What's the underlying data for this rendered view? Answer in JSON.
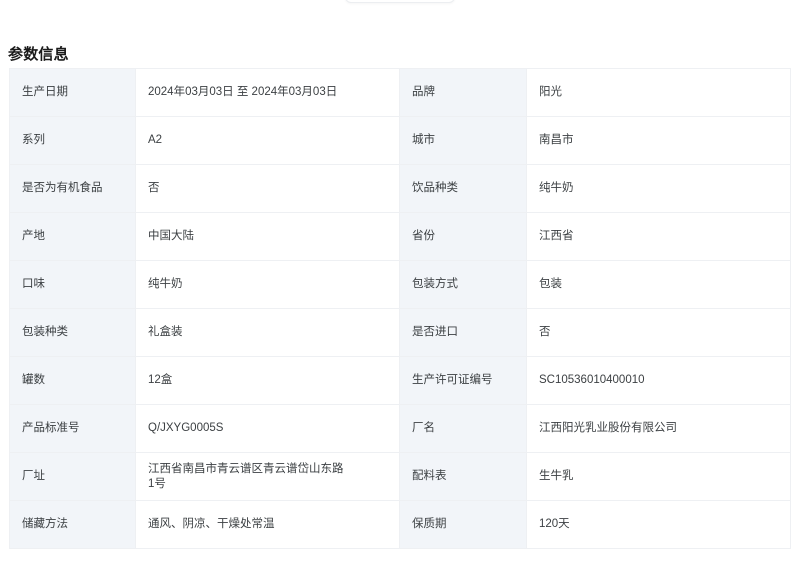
{
  "section": {
    "title": "参数信息"
  },
  "table": {
    "rows": [
      {
        "left": {
          "label": "生产日期",
          "value": "2024年03月03日 至 2024年03月03日"
        },
        "right": {
          "label": "品牌",
          "value": "阳光"
        }
      },
      {
        "left": {
          "label": "系列",
          "value": "A2"
        },
        "right": {
          "label": "城市",
          "value": "南昌市"
        }
      },
      {
        "left": {
          "label": "是否为有机食品",
          "value": "否"
        },
        "right": {
          "label": "饮品种类",
          "value": "纯牛奶"
        }
      },
      {
        "left": {
          "label": "产地",
          "value": "中国大陆"
        },
        "right": {
          "label": "省份",
          "value": "江西省"
        }
      },
      {
        "left": {
          "label": "口味",
          "value": "纯牛奶"
        },
        "right": {
          "label": "包装方式",
          "value": "包装"
        }
      },
      {
        "left": {
          "label": "包装种类",
          "value": "礼盒装"
        },
        "right": {
          "label": "是否进口",
          "value": "否"
        }
      },
      {
        "left": {
          "label": "罐数",
          "value": "12盒"
        },
        "right": {
          "label": "生产许可证编号",
          "value": "SC10536010400010"
        }
      },
      {
        "left": {
          "label": "产品标准号",
          "value": "Q/JXYG0005S"
        },
        "right": {
          "label": "厂名",
          "value": "江西阳光乳业股份有限公司"
        }
      },
      {
        "left": {
          "label": "厂址",
          "value": "江西省南昌市青云谱区青云谱岱山东路\n1号"
        },
        "right": {
          "label": "配料表",
          "value": "生牛乳"
        }
      },
      {
        "left": {
          "label": "储藏方法",
          "value": "通风、阴凉、干燥处常温"
        },
        "right": {
          "label": "保质期",
          "value": "120天"
        }
      }
    ]
  },
  "colors": {
    "label_bg": "#f2f5f9",
    "value_bg": "#ffffff",
    "border": "#eef0f3",
    "title_text": "#1a1a1a",
    "body_text": "#3c4043"
  }
}
